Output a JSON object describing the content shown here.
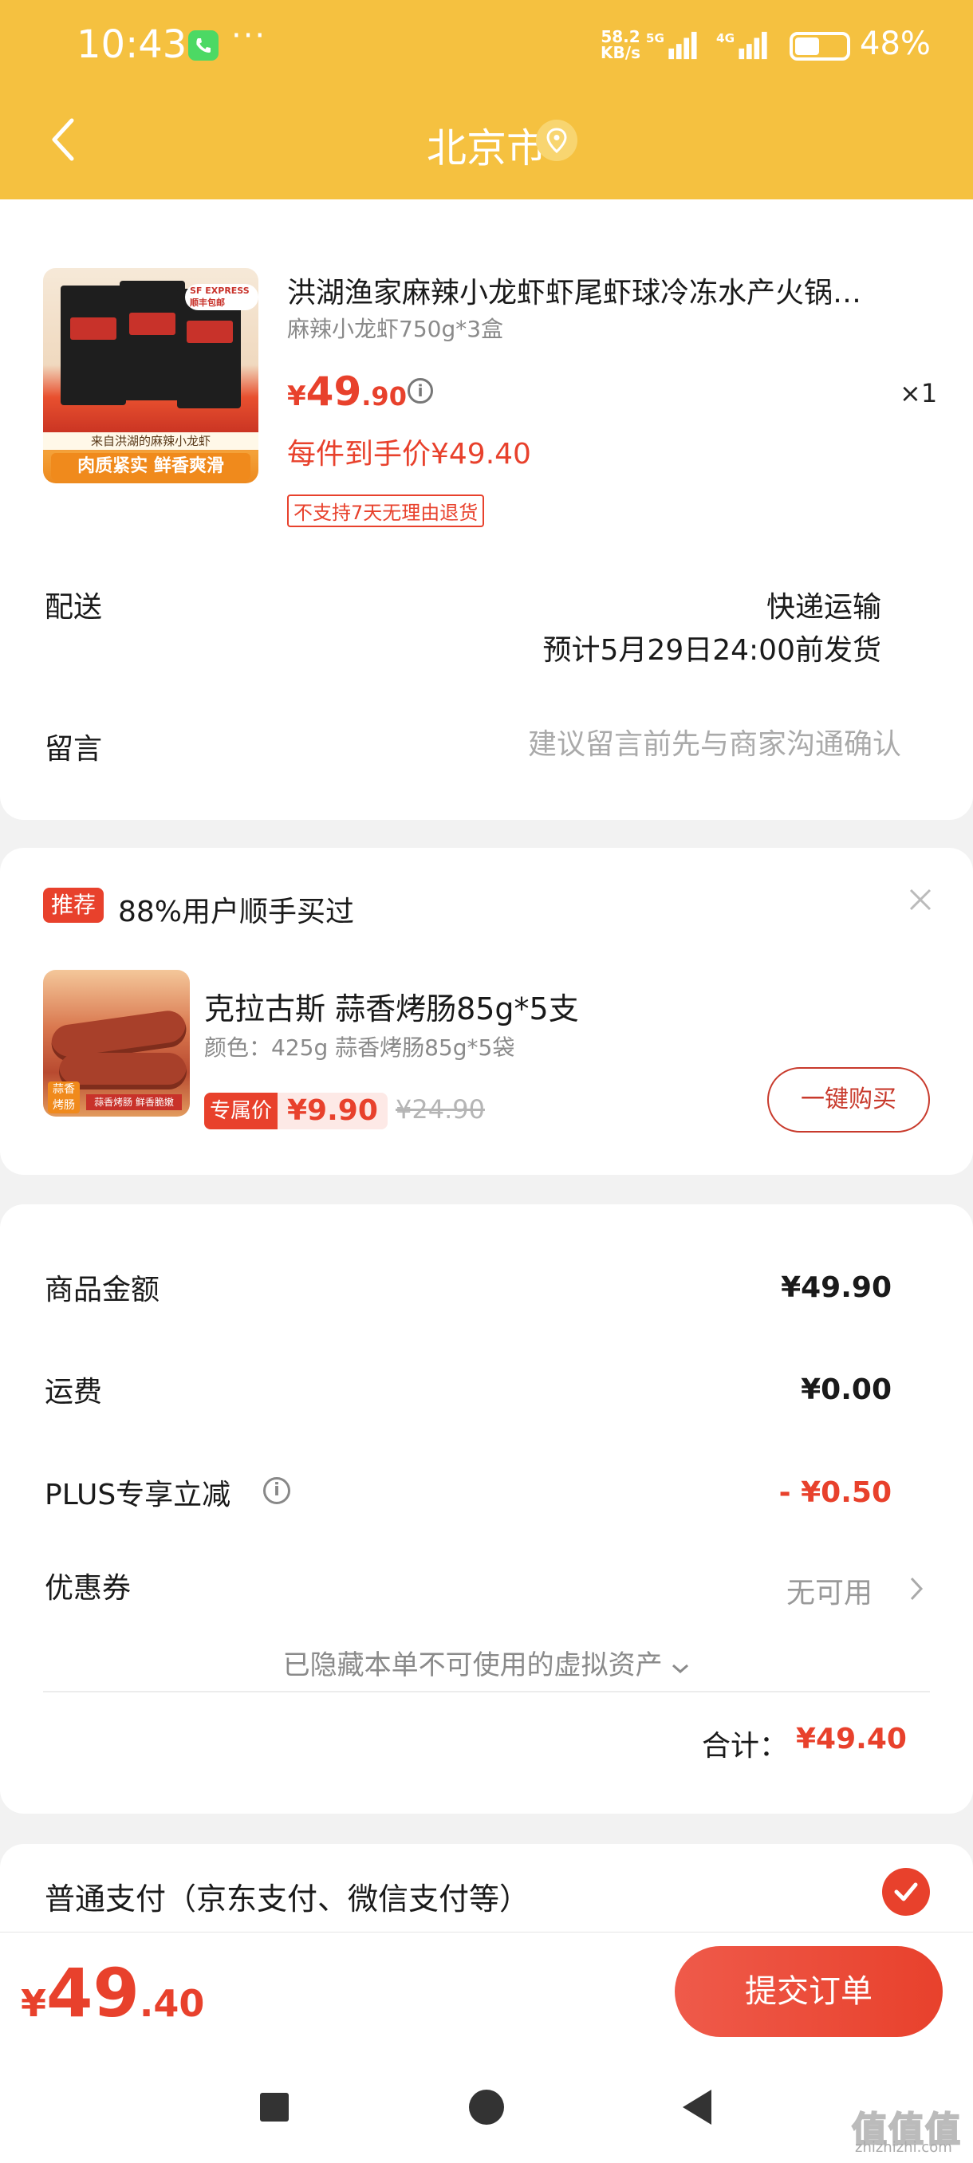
{
  "status_bar": {
    "time": "10:43",
    "dots": "···",
    "net_speed": "58.2 KB/s",
    "net1": "5G",
    "net2": "4G",
    "battery_pct": "48%",
    "battery_level": 0.48
  },
  "header": {
    "title": "北京市"
  },
  "product": {
    "title": "洪湖渔家麻辣小龙虾虾尾虾球冷冻水产火锅…",
    "spec": "麻辣小龙虾750g*3盒",
    "price_symbol": "¥",
    "price_int": "49",
    "price_dec": ".90",
    "quantity": "×1",
    "final_price_text": "每件到手价¥49.40",
    "no_return_tag": "不支持7天无理由退货",
    "image_caption": "来自洪湖的麻辣小龙虾",
    "image_banner": "肉质紧实 鲜香爽滑",
    "image_badge": "SF EXPRESS 顺丰包邮"
  },
  "delivery": {
    "label": "配送",
    "method": "快递运输",
    "eta": "预计5月29日24:00前发货"
  },
  "message": {
    "label": "留言",
    "placeholder": "建议留言前先与商家沟通确认"
  },
  "recommend": {
    "badge": "推荐",
    "title": "88%用户顺手买过",
    "name": "克拉古斯 蒜香烤肠85g*5支",
    "spec": "颜色：425g 蒜香烤肠85g*5袋",
    "exclusive_label": "专属价",
    "exclusive_price": "¥9.90",
    "original_price": "¥24.90",
    "buy_button": "一键购买",
    "image_tag": "蒜香烤肠",
    "image_caption": "蒜香烤肠 鲜香脆嫩"
  },
  "summary": {
    "goods_label": "商品金额",
    "goods_value": "¥49.90",
    "shipping_label": "运费",
    "shipping_value": "¥0.00",
    "plus_label": "PLUS专享立减",
    "plus_value": "- ¥0.50",
    "coupon_label": "优惠券",
    "coupon_value": "无可用",
    "hidden_assets": "已隐藏本单不可使用的虚拟资产",
    "total_label": "合计：",
    "total_value": "¥49.40"
  },
  "payment": {
    "label": "普通支付（京东支付、微信支付等）"
  },
  "footer": {
    "price_symbol": "¥",
    "price_int": "49",
    "price_dec": ".40",
    "submit": "提交订单"
  },
  "watermark": {
    "text": "值值值",
    "domain": "zhizhizhi.com"
  },
  "colors": {
    "header_bg": "#f5c140",
    "accent_red": "#e8412c",
    "gray_text": "#8a8a8a"
  }
}
